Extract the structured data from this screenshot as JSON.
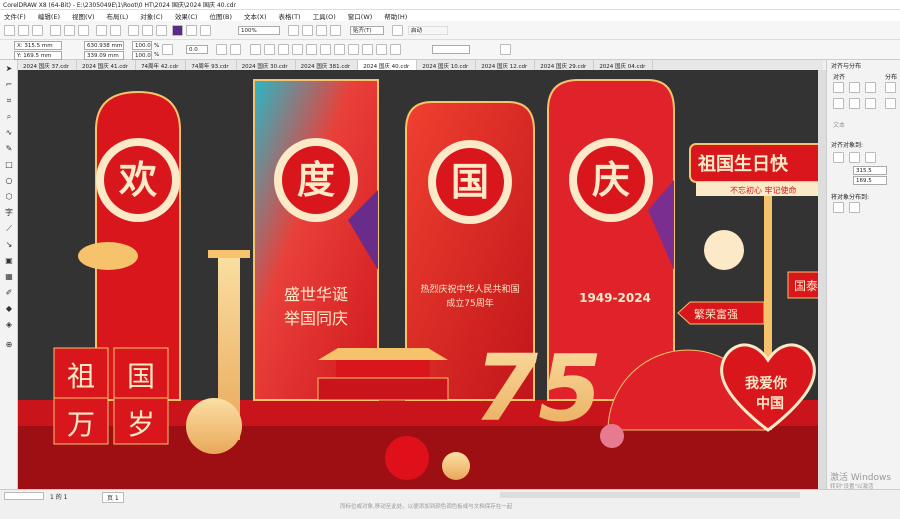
{
  "titlebar": {
    "text": "CorelDRAW X8 (64-Bit) - E:\\2305049E\\1\\Root\\0 HT\\2024 国庆\\2024 国庆 40.cdr"
  },
  "menu": [
    "文件(F)",
    "编辑(E)",
    "视图(V)",
    "布局(L)",
    "对象(C)",
    "效果(C)",
    "位图(B)",
    "文本(X)",
    "表格(T)",
    "工具(O)",
    "窗口(W)",
    "帮助(H)"
  ],
  "toolbar": {
    "zoom": "100%",
    "snap": "贴齐(T)",
    "launch": "启动"
  },
  "props": {
    "x": "X: 315.5 mm",
    "y": "Y: 169.5 mm",
    "w": "630.938 mm",
    "h": "339.09 mm",
    "sx": "100.0",
    "sy": "100.0",
    "pct": "%",
    "angle": "0.0"
  },
  "tabs": [
    "2024 国庆 37.cdr",
    "2024 国庆 41.cdr",
    "74周年 42.cdr",
    "74周年 93.cdr",
    "2024 国庆 30.cdr",
    "2024 国庆 381.cdr",
    "2024 国庆 40.cdr",
    "2024 国庆 10.cdr",
    "2024 国庆 12.cdr",
    "2024 国庆 29.cdr",
    "2024 国庆 04.cdr"
  ],
  "artwork": {
    "big_chars": [
      "欢",
      "度",
      "国",
      "庆"
    ],
    "slogan1_line1": "盛世华诞",
    "slogan1_line2": "举国同庆",
    "slogan2_line1": "热烈庆祝中华人民共和国",
    "slogan2_line2": "成立75周年",
    "years": "1949-2024",
    "block_chars": [
      "祖",
      "国",
      "万",
      "岁"
    ],
    "anniv": "75",
    "sign_title": "祖国生日快",
    "sign_sub": "不忘初心 牢记使命",
    "arrow1": "国泰",
    "arrow2": "繁荣富强",
    "heart_line1": "我爱你",
    "heart_line2": "中国"
  },
  "docker": {
    "tab": "对齐与分布",
    "label_align": "对齐",
    "label_dist": "分布",
    "text_label": "文本",
    "align_obj": "对齐对象到:",
    "x": "315.5",
    "y": "169.5",
    "dist_to": "将对象分布到:"
  },
  "status": {
    "page_counter": "1 的 1",
    "page_tab": "页 1",
    "hint": "而标位或对象,移动至此处。以便添加到颜色调色板或与文档保存在一起",
    "activate1": "激活 Windows",
    "activate2": "转到\"设置\"以激活"
  },
  "colors": {
    "red": "#d9161c",
    "gold": "#f6c26b",
    "dark": "#333333"
  }
}
